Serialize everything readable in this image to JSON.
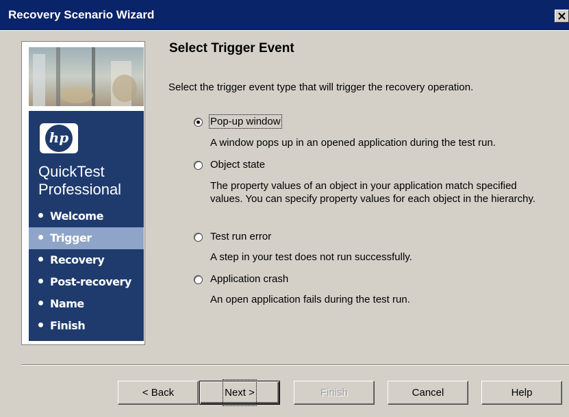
{
  "window": {
    "title": "Recovery Scenario Wizard"
  },
  "sidebar": {
    "logo_text": "hp",
    "product_line1": "QuickTest",
    "product_line2": "Professional",
    "steps": [
      {
        "label": "Welcome",
        "active": false
      },
      {
        "label": "Trigger",
        "active": true
      },
      {
        "label": "Recovery",
        "active": false
      },
      {
        "label": "Post-recovery",
        "active": false
      },
      {
        "label": "Name",
        "active": false
      },
      {
        "label": "Finish",
        "active": false
      }
    ]
  },
  "main": {
    "heading": "Select Trigger Event",
    "instruction": "Select the trigger event type that will trigger the recovery operation.",
    "options": [
      {
        "label": "Pop-up window",
        "selected": true,
        "description": "A window pops up in an opened application during the test run."
      },
      {
        "label": "Object state",
        "selected": false,
        "description": "The property values of an object in your application match specified values. You can specify property values for each object in the hierarchy."
      },
      {
        "label": "Test run error",
        "selected": false,
        "description": "A step in your test does not run successfully."
      },
      {
        "label": "Application crash",
        "selected": false,
        "description": "An open application fails during the test run."
      }
    ]
  },
  "buttons": {
    "back": "< Back",
    "next": "Next >",
    "finish": "Finish",
    "cancel": "Cancel",
    "help": "Help"
  },
  "colors": {
    "title_bar": "#0a246a",
    "nav_panel": "#1f3b6e",
    "nav_active": "#8ea4c8",
    "dialog_bg": "#d4d0c8"
  }
}
